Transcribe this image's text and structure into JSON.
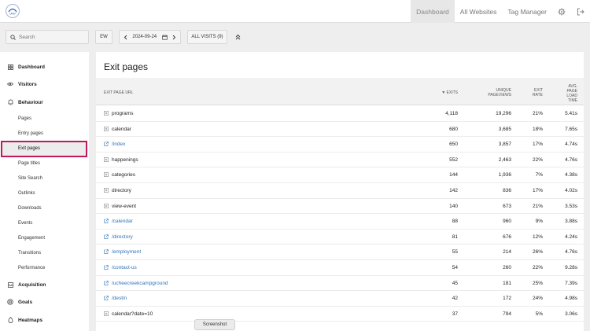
{
  "topnav": {
    "logo_text": "UNIV",
    "dashboard": "Dashboard",
    "all_websites": "All Websites",
    "tag_manager": "Tag Manager",
    "settings_icon": "gear-icon",
    "logout_icon": "logout-icon"
  },
  "controls": {
    "search_placeholder": "Search",
    "segment_label": "EW",
    "date": "2024-09-24",
    "visits_label": "ALL VISITS",
    "visits_count": "(9)"
  },
  "sidebar": {
    "dashboard": "Dashboard",
    "visitors": "Visitors",
    "behaviour": "Behaviour",
    "behaviour_items": [
      "Pages",
      "Entry pages",
      "Exit pages",
      "Page titles",
      "Site Search",
      "Outlinks",
      "Downloads",
      "Events",
      "Engagement",
      "Transitions",
      "Performance"
    ],
    "acquisition": "Acquisition",
    "goals": "Goals",
    "heatmaps": "Heatmaps"
  },
  "report": {
    "title": "Exit pages",
    "columns": {
      "url": "EXIT PAGE URL",
      "exits": "EXITS",
      "unique_1": "UNIQUE",
      "unique_2": "PAGEVIEWS",
      "rate_1": "EXIT",
      "rate_2": "RATE",
      "load_1": "AVG.",
      "load_2": "PAGE",
      "load_3": "LOAD",
      "load_4": "TIME"
    },
    "rows": [
      {
        "url": "programs",
        "type": "folder",
        "exits": "4,118",
        "pageviews": "19,296",
        "rate": "21%",
        "load": "5.41s"
      },
      {
        "url": "calendar",
        "type": "folder",
        "exits": "680",
        "pageviews": "3,685",
        "rate": "18%",
        "load": "7.65s"
      },
      {
        "url": "/index",
        "type": "link",
        "exits": "650",
        "pageviews": "3,857",
        "rate": "17%",
        "load": "4.74s"
      },
      {
        "url": "happenings",
        "type": "folder",
        "exits": "552",
        "pageviews": "2,463",
        "rate": "22%",
        "load": "4.76s"
      },
      {
        "url": "categories",
        "type": "folder",
        "exits": "144",
        "pageviews": "1,936",
        "rate": "7%",
        "load": "4.38s"
      },
      {
        "url": "directory",
        "type": "folder",
        "exits": "142",
        "pageviews": "836",
        "rate": "17%",
        "load": "4.02s"
      },
      {
        "url": "view-event",
        "type": "folder",
        "exits": "140",
        "pageviews": "673",
        "rate": "21%",
        "load": "3.53s"
      },
      {
        "url": "/calendar",
        "type": "link",
        "exits": "88",
        "pageviews": "960",
        "rate": "9%",
        "load": "3.88s"
      },
      {
        "url": "/directory",
        "type": "link",
        "exits": "81",
        "pageviews": "676",
        "rate": "12%",
        "load": "4.24s"
      },
      {
        "url": "/employment",
        "type": "link",
        "exits": "55",
        "pageviews": "214",
        "rate": "26%",
        "load": "4.76s"
      },
      {
        "url": "/contact-us",
        "type": "link",
        "exits": "54",
        "pageviews": "260",
        "rate": "22%",
        "load": "9.28s"
      },
      {
        "url": "/ucheecreekcampground",
        "type": "link",
        "exits": "45",
        "pageviews": "181",
        "rate": "25%",
        "load": "7.39s"
      },
      {
        "url": "/destin",
        "type": "link",
        "exits": "42",
        "pageviews": "172",
        "rate": "24%",
        "load": "4.98s"
      },
      {
        "url": "calendar?date=10",
        "type": "folder",
        "exits": "37",
        "pageviews": "794",
        "rate": "5%",
        "load": "3.06s"
      }
    ]
  },
  "toast": "Screenshot",
  "colors": {
    "accent": "#c2185b",
    "link": "#2f73b8"
  }
}
